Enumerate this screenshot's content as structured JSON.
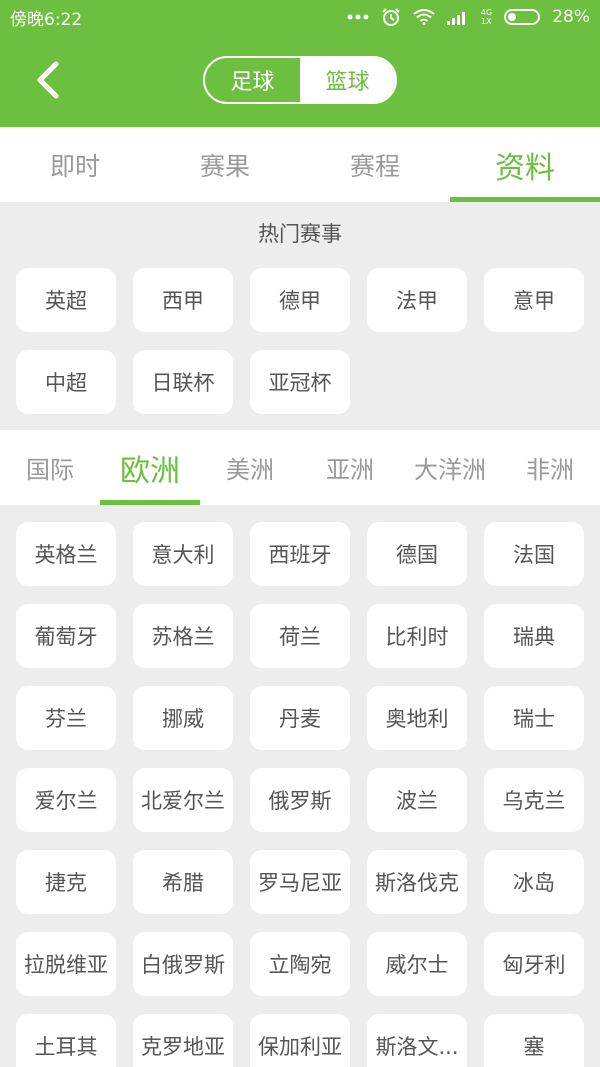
{
  "status_bar": {
    "time": "傍晚6:22",
    "network_label": "4G",
    "sim_label": "1X",
    "battery": "28%",
    "icons": [
      "dots-icon",
      "alarm-icon",
      "wifi-icon",
      "signal-icon",
      "battery-icon"
    ]
  },
  "header": {
    "sport_toggle": [
      {
        "label": "足球",
        "selected": false
      },
      {
        "label": "篮球",
        "selected": true
      }
    ]
  },
  "tabs": [
    {
      "label": "即时",
      "active": false
    },
    {
      "label": "赛果",
      "active": false
    },
    {
      "label": "赛程",
      "active": false
    },
    {
      "label": "资料",
      "active": true
    }
  ],
  "hot_section": {
    "title": "热门赛事",
    "items": [
      "英超",
      "西甲",
      "德甲",
      "法甲",
      "意甲",
      "中超",
      "日联杯",
      "亚冠杯"
    ]
  },
  "region_tabs": [
    {
      "label": "国际",
      "active": false
    },
    {
      "label": "欧洲",
      "active": true
    },
    {
      "label": "美洲",
      "active": false
    },
    {
      "label": "亚洲",
      "active": false
    },
    {
      "label": "大洋洲",
      "active": false
    },
    {
      "label": "非洲",
      "active": false
    }
  ],
  "countries": [
    "英格兰",
    "意大利",
    "西班牙",
    "德国",
    "法国",
    "葡萄牙",
    "苏格兰",
    "荷兰",
    "比利时",
    "瑞典",
    "芬兰",
    "挪威",
    "丹麦",
    "奥地利",
    "瑞士",
    "爱尔兰",
    "北爱尔兰",
    "俄罗斯",
    "波兰",
    "乌克兰",
    "捷克",
    "希腊",
    "罗马尼亚",
    "斯洛伐克",
    "冰岛",
    "拉脱维亚",
    "白俄罗斯",
    "立陶宛",
    "威尔士",
    "匈牙利",
    "土耳其",
    "克罗地亚",
    "保加利亚",
    "斯洛文...",
    "塞"
  ],
  "colors": {
    "accent": "#6dbf3f",
    "background": "#ededed",
    "chip": "#ffffff",
    "inactive_text": "#9a9a9a"
  }
}
